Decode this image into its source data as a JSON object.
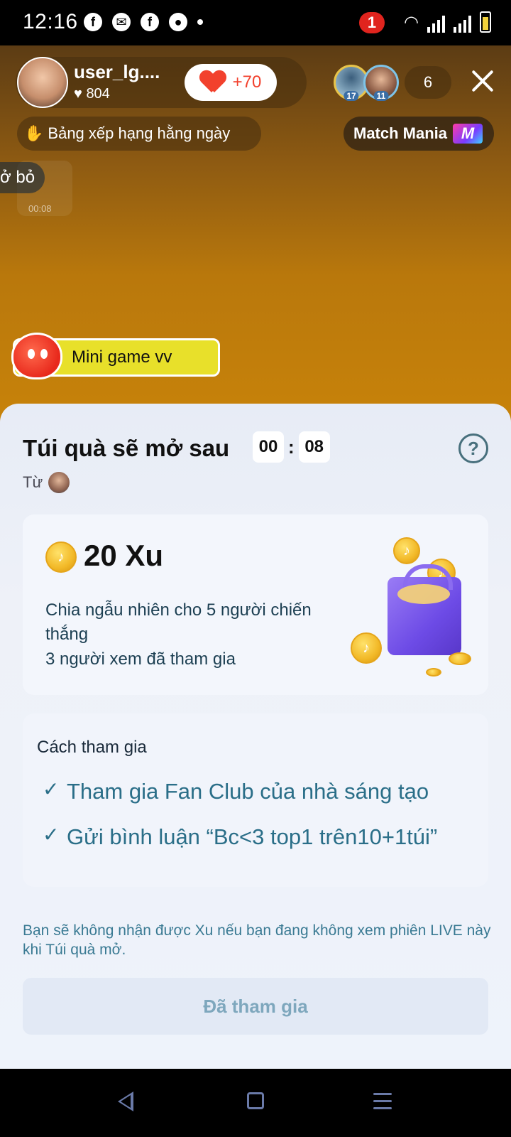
{
  "status_bar": {
    "time": "12:16",
    "notification_count": "1",
    "app_icons": [
      "facebook-icon",
      "messenger-icon",
      "facebook-icon",
      "chat-bubble-icon"
    ]
  },
  "live": {
    "host_name": "user_lg....",
    "host_likes": "804",
    "follow_label": "+70",
    "viewers": [
      {
        "badge": "17"
      },
      {
        "badge": "11"
      }
    ],
    "viewer_count": "6",
    "daily_ranking": "Bảng xếp hạng hằng ngày",
    "match_label": "Match Mania",
    "match_logo": "M",
    "side_comment": "ở bỏ",
    "side_bag_label": "00:08",
    "minigame_label": "Mini game vv"
  },
  "sheet": {
    "title": "Túi quà sẽ mở sau",
    "timer_minutes": "00",
    "timer_colon": ":",
    "timer_seconds": "08",
    "help": "?",
    "from_label": "Từ",
    "prize_amount": "20 Xu",
    "prize_desc": "Chia ngẫu nhiên cho 5 người chiến thắng",
    "prize_joined": "3 người xem đã tham gia",
    "how_title": "Cách tham gia",
    "requirements": [
      "Tham gia Fan Club của nhà sáng tạo",
      "Gửi bình luận “Bc<3 top1 trên10+1túi”"
    ],
    "check_mark": "✓",
    "note": "Bạn sẽ không nhận được Xu nếu bạn đang không xem phiên LIVE này khi Túi quà mở.",
    "joined_button": "Đã tham gia"
  },
  "colors": {
    "live_bg": "#c8830a",
    "accent_teal": "#2a6e88",
    "heart_red": "#f2412d",
    "minigame_yellow": "#e8e02a"
  }
}
